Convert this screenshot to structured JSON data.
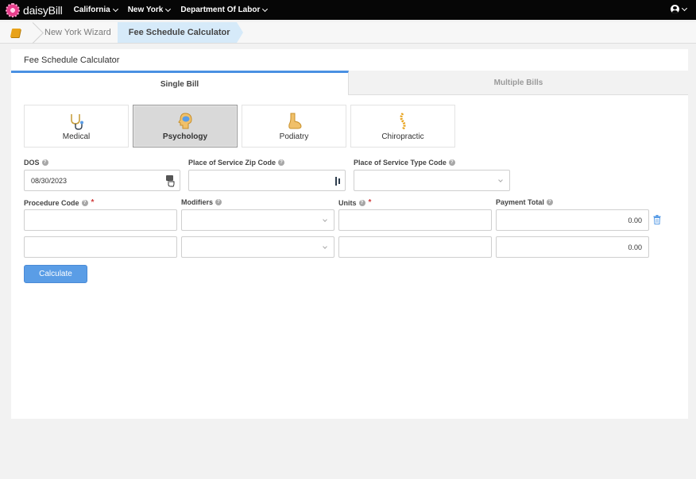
{
  "brand": {
    "name": "daisyBill"
  },
  "nav": {
    "items": [
      {
        "label": "California"
      },
      {
        "label": "New York"
      },
      {
        "label": "Department Of Labor"
      }
    ]
  },
  "breadcrumb": {
    "items": [
      {
        "label": "New York Wizard"
      },
      {
        "label": "Fee Schedule Calculator"
      }
    ]
  },
  "panel": {
    "title": "Fee Schedule Calculator"
  },
  "tabs": [
    {
      "label": "Single Bill",
      "active": true
    },
    {
      "label": "Multiple Bills",
      "active": false
    }
  ],
  "categories": [
    {
      "label": "Medical",
      "icon": "stethoscope-icon"
    },
    {
      "label": "Psychology",
      "icon": "brain-icon",
      "selected": true
    },
    {
      "label": "Podiatry",
      "icon": "foot-icon"
    },
    {
      "label": "Chiropractic",
      "icon": "spine-icon"
    }
  ],
  "form": {
    "dos": {
      "label": "DOS",
      "value": "08/30/2023"
    },
    "zip": {
      "label": "Place of Service Zip Code",
      "value": ""
    },
    "pos_type": {
      "label": "Place of Service Type Code",
      "value": ""
    },
    "procedure": {
      "label": "Procedure Code"
    },
    "modifiers": {
      "label": "Modifiers"
    },
    "units": {
      "label": "Units"
    },
    "payment": {
      "label": "Payment Total"
    },
    "rows": [
      {
        "procedure": "",
        "modifiers": "",
        "units": "",
        "payment": "0.00"
      },
      {
        "procedure": "",
        "modifiers": "",
        "units": "",
        "payment": "0.00"
      }
    ],
    "calculate_label": "Calculate"
  },
  "colors": {
    "accent": "#4a90e2",
    "topbar": "#060606",
    "crumb_active": "#d6eaf9"
  }
}
